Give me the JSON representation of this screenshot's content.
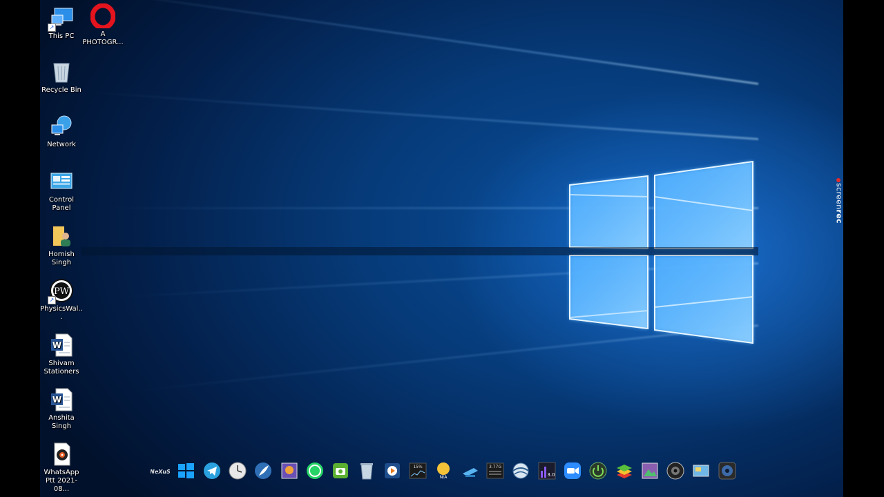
{
  "desktop_icons": [
    {
      "label": "This PC",
      "icon": "this-pc-icon"
    },
    {
      "label": "A PHOTOGR...",
      "icon": "opera-icon"
    },
    {
      "label": "Recycle Bin",
      "icon": "recycle-bin-icon"
    },
    {
      "label": "Network",
      "icon": "network-icon"
    },
    {
      "label": "Control Panel",
      "icon": "control-panel-icon"
    },
    {
      "label": "Homish Singh",
      "icon": "user-folder-icon"
    },
    {
      "label": "PhysicsWal...",
      "icon": "physicswallah-icon"
    },
    {
      "label": "Shivam Stationers",
      "icon": "word-document-icon"
    },
    {
      "label": "Anshita Singh",
      "icon": "word-document-icon"
    },
    {
      "label": "WhatsApp Ptt 2021-08...",
      "icon": "audio-file-icon"
    }
  ],
  "dock": {
    "items": [
      "nexus-icon",
      "windows-start-icon",
      "telegram-icon",
      "clock-icon",
      "feather-icon",
      "photo-viewer-icon",
      "whatsapp-icon",
      "camera-app-icon",
      "recycle-bin-icon",
      "media-player-icon",
      "cpu-meter-icon",
      "weather-icon",
      "network-monitor-icon",
      "disk-meter-icon",
      "browser-globe-icon",
      "equalizer-icon",
      "zoom-icon",
      "power-icon",
      "bluestacks-icon",
      "gallery-icon",
      "speaker-icon",
      "screenshot-icon",
      "webcam-icon"
    ],
    "labels": {
      "nexus": "NeXuS",
      "cpu": "15%",
      "weather": "N/A",
      "disk": "3.77G",
      "equalizer": "3.0"
    }
  },
  "overlay": {
    "screenrec_prefix": "screen",
    "screenrec_bold": "rec"
  },
  "colors": {
    "accent": "#0a74e6",
    "background": "#063a78"
  }
}
